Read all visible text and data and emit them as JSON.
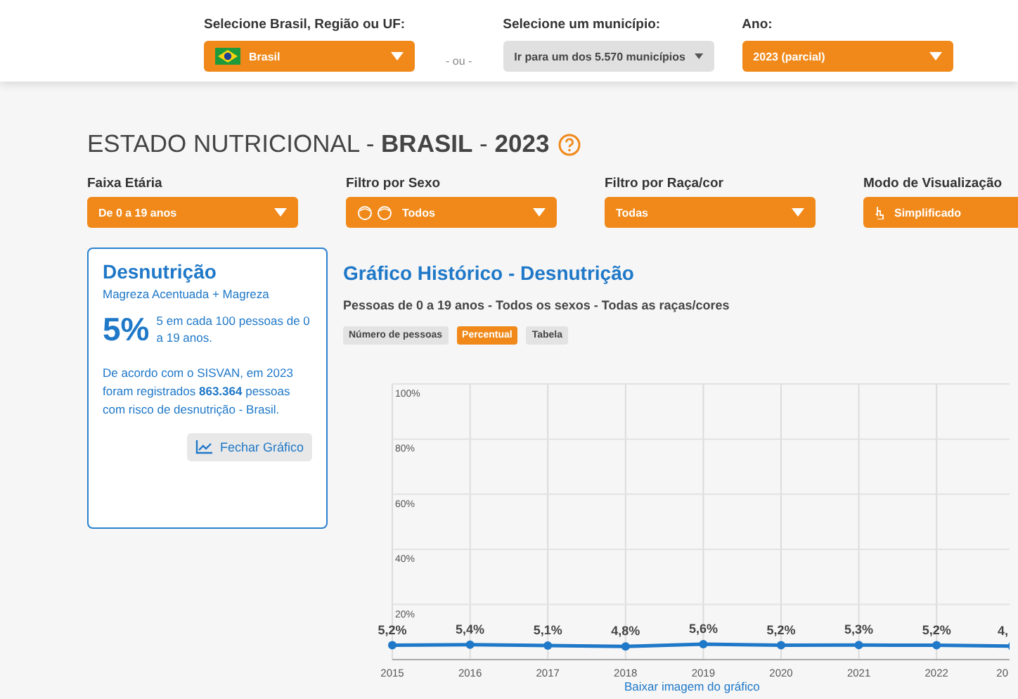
{
  "top_bar": {
    "region_select": {
      "label": "Selecione Brasil, Região ou UF:",
      "value": "Brasil"
    },
    "separator": "- ou -",
    "municipality_select": {
      "label": "Selecione um município:",
      "value": "Ir para um dos 5.570 municípios"
    },
    "year_select": {
      "label": "Ano:",
      "value": "2023 (parcial)"
    }
  },
  "title": "ESTADO NUTRICIONAL - **BRASIL** - **2023**",
  "filters": [
    {
      "label": "Faixa Etária",
      "value": "De 0 a 19 anos",
      "kind": "plain"
    },
    {
      "label": "Filtro por Sexo",
      "value": "Todos",
      "kind": "sex"
    },
    {
      "label": "Filtro por Raça/cor",
      "value": "Todas",
      "kind": "plain"
    },
    {
      "label": "Modo de Visualização",
      "value": "Simplificado",
      "kind": "mode"
    }
  ],
  "summary_card": {
    "title": "Desnutrição",
    "subtitle": "Magreza Acentuada + Magreza",
    "percent": "5%",
    "percent_note": "5 em cada 100 pessoas de 0 a 19 anos.",
    "description": "De acordo com o SISVAN, em 2023 foram registrados **863.364** pessoas com risco de desnutrição - Brasil.",
    "button": "Fechar Gráfico"
  },
  "chart_panel": {
    "title": "Gráfico Histórico - Desnutrição",
    "subtitle": "Pessoas de 0 a 19 anos - Todos os sexos - Todas as raças/cores",
    "view_tabs": [
      {
        "label": "Número de pessoas",
        "selected": false
      },
      {
        "label": "Percentual",
        "selected": true
      },
      {
        "label": "Tabela",
        "selected": false
      }
    ],
    "chart_data": {
      "type": "line",
      "categories": [
        "2015",
        "2016",
        "2017",
        "2018",
        "2019",
        "2020",
        "2021",
        "2022",
        "20"
      ],
      "grid": true,
      "series": [
        {
          "color": "#1f78c8",
          "marker": "circle",
          "values": [
            5.2,
            5.4,
            5.1,
            4.8,
            5.6,
            5.2,
            5.3,
            5.2,
            4.9
          ]
        }
      ],
      "value_labels": [
        "5,2%",
        "5,4%",
        "5,1%",
        "4,8%",
        "5,6%",
        "5,2%",
        "5,3%",
        "5,2%",
        "4,"
      ],
      "ylim": [
        0,
        100
      ],
      "yticks": [
        {
          "value": 20,
          "label": "20%"
        },
        {
          "value": 40,
          "label": "40%"
        },
        {
          "value": 60,
          "label": "60%"
        },
        {
          "value": 80,
          "label": "80%"
        },
        {
          "value": 100,
          "label": "100%"
        }
      ]
    },
    "download_link": "Baixar imagem do gráfico"
  }
}
